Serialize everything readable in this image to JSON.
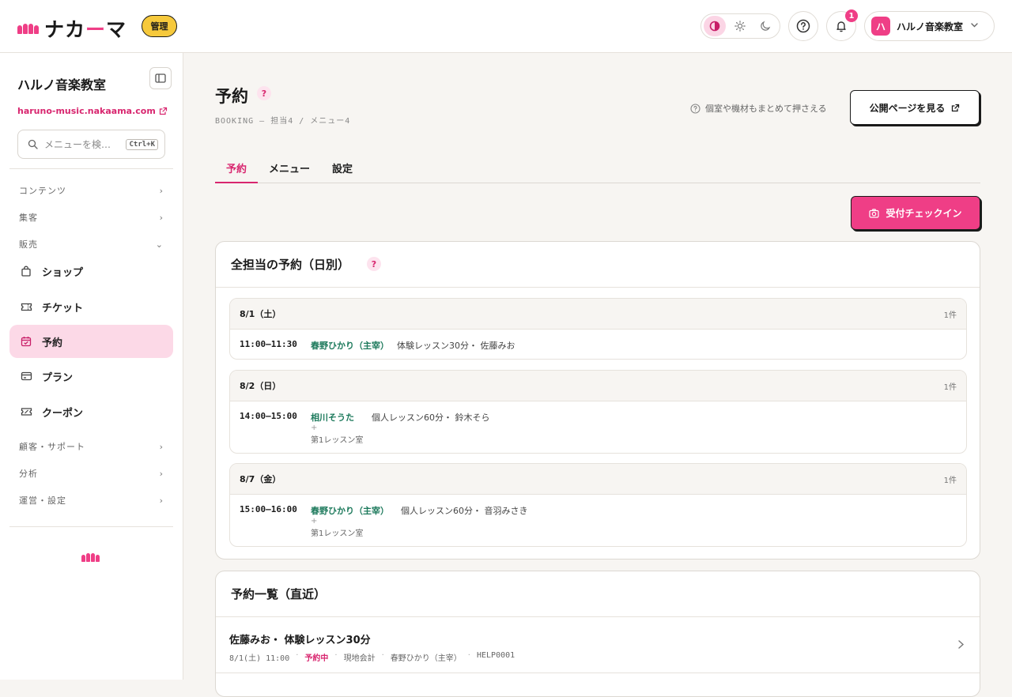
{
  "header": {
    "logo_text_a": "ナカ",
    "logo_text_b": "ー",
    "logo_text_c": "マ",
    "admin_badge": "管理",
    "notification_count": "1",
    "account_initial": "ハ",
    "account_name": "ハルノ音楽教室"
  },
  "sidebar": {
    "school_name": "ハルノ音楽教室",
    "site_url": "haruno-music.nakaama.com",
    "search_placeholder": "メニューを検…",
    "search_shortcut": "Ctrl+K",
    "sections": {
      "content": "コンテンツ",
      "marketing": "集客",
      "sales": "販売",
      "customers": "顧客・サポート",
      "analytics": "分析",
      "operations": "運営・設定"
    },
    "items": {
      "shop": "ショップ",
      "ticket": "チケット",
      "booking": "予約",
      "plan": "プラン",
      "coupon": "クーポン"
    }
  },
  "main": {
    "title": "予約",
    "breadcrumb": "BOOKING — 担当4 / メニュー4",
    "hint": "個室や機材もまとめて押さえる",
    "public_button": "公開ページを見る",
    "tabs": {
      "booking": "予約",
      "menu": "メニュー",
      "settings": "設定"
    },
    "checkin_button": "受付チェックイン",
    "daily": {
      "title": "全担当の予約（日別）",
      "days": [
        {
          "date": "8/1（土）",
          "count": "1件",
          "time": "11:00–11:30",
          "staff": "春野ひかり（主宰）",
          "detail": "体験レッスン30分・ 佐藤みお"
        },
        {
          "date": "8/2（日）",
          "count": "1件",
          "time": "14:00–15:00",
          "staff": "相川そうた",
          "detail": "個人レッスン60分・ 鈴木そら",
          "plus": "+",
          "room": "第1レッスン室"
        },
        {
          "date": "8/7（金）",
          "count": "1件",
          "time": "15:00–16:00",
          "staff": "春野ひかり（主宰）",
          "detail": "個人レッスン60分・ 音羽みさき",
          "plus": "+",
          "room": "第1レッスン室"
        }
      ]
    },
    "list": {
      "title": "予約一覧（直近）",
      "rows": [
        {
          "title": "佐藤みお・ 体験レッスン30分",
          "datetime": "8/1(土) 11:00",
          "status": "予約中",
          "payment": "現地会計",
          "staff": "春野ひかり（主宰）",
          "code": "HELP0001"
        }
      ]
    }
  },
  "colors": {
    "accent": "#ef3e86",
    "accent_dark": "#d8266f",
    "staff_green": "#1d7a5c",
    "badge_yellow": "#f6c93c"
  }
}
